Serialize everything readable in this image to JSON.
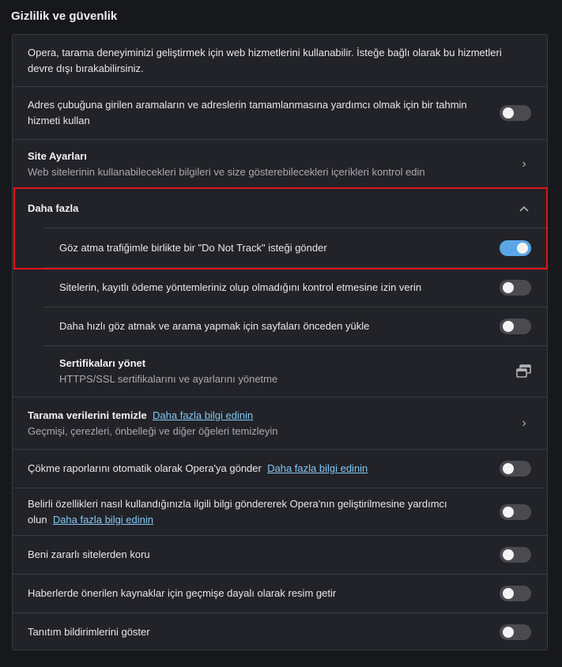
{
  "page_title": "Gizlilik ve güvenlik",
  "intro": "Opera, tarama deneyiminizi geliştirmek için web hizmetlerini kullanabilir. İsteğe bağlı olarak bu hizmetleri devre dışı bırakabilirsiniz.",
  "prediction": {
    "label": "Adres çubuğuna girilen aramaların ve adreslerin tamamlanmasına yardımcı olmak için bir tahmin hizmeti kullan",
    "enabled": false
  },
  "site_settings": {
    "title": "Site Ayarları",
    "desc": "Web sitelerinin kullanabilecekleri bilgileri ve size gösterebilecekleri içerikleri kontrol edin"
  },
  "more": {
    "title": "Daha fazla",
    "expanded": true,
    "do_not_track": {
      "label": "Göz atma trafiğimle birlikte bir \"Do Not Track\" isteği gönder",
      "enabled": true
    },
    "payment_methods": {
      "label": "Sitelerin, kayıtlı ödeme yöntemleriniz olup olmadığını kontrol etmesine izin verin",
      "enabled": false
    },
    "preload": {
      "label": "Daha hızlı göz atmak ve arama yapmak için sayfaları önceden yükle",
      "enabled": false
    },
    "certificates": {
      "title": "Sertifikaları yönet",
      "desc": "HTTPS/SSL sertifikalarını ve ayarlarını yönetme"
    }
  },
  "clear_data": {
    "title": "Tarama verilerini temizle",
    "link": "Daha fazla bilgi edinin",
    "desc": "Geçmişi, çerezleri, önbelleği ve diğer öğeleri temizleyin"
  },
  "crash_reports": {
    "label": "Çökme raporlarını otomatik olarak Opera'ya gönder",
    "link": "Daha fazla bilgi edinin",
    "enabled": false
  },
  "usage_stats": {
    "label": "Belirli özellikleri nasıl kullandığınızla ilgili bilgi göndererek Opera'nın geliştirilmesine yardımcı olun",
    "link": "Daha fazla bilgi edinin",
    "enabled": false
  },
  "protect": {
    "label": "Beni zararlı sitelerden koru",
    "enabled": false
  },
  "news_images": {
    "label": "Haberlerde önerilen kaynaklar için geçmişe dayalı olarak resim getir",
    "enabled": false
  },
  "promo": {
    "label": "Tanıtım bildirimlerini göster",
    "enabled": false
  },
  "colors": {
    "accent": "#5aa6e6",
    "link": "#82c8f5",
    "highlight": "#e0141b"
  }
}
